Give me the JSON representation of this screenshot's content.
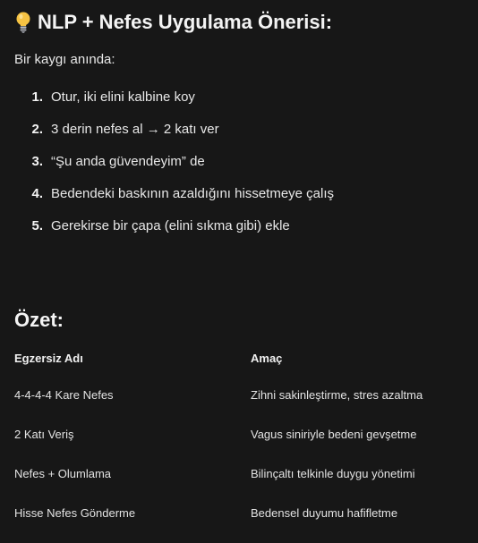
{
  "title": {
    "icon": "lightbulb-icon",
    "text": "NLP + Nefes Uygulama Önerisi:"
  },
  "intro": "Bir kaygı anında:",
  "steps": [
    {
      "number": "1.",
      "text": "Otur, iki elini kalbine koy"
    },
    {
      "number": "2.",
      "text": "3 derin nefes al → 2 katı ver"
    },
    {
      "number": "3.",
      "text": "“Şu anda güvendeyim” de"
    },
    {
      "number": "4.",
      "text": "Bedendeki baskının azaldığını hissetmeye çalış"
    },
    {
      "number": "5.",
      "text": "Gerekirse bir çapa (elini sıkma gibi) ekle"
    }
  ],
  "summary": {
    "heading": "Özet:",
    "columns": [
      "Egzersiz Adı",
      "Amaç"
    ],
    "rows": [
      [
        "4-4-4-4 Kare Nefes",
        "Zihni sakinleştirme, stres azaltma"
      ],
      [
        "2 Katı Veriş",
        "Vagus siniriyle bedeni gevşetme"
      ],
      [
        "Nefes + Olumlama",
        "Bilinçaltı telkinle duygu yönetimi"
      ],
      [
        "Hisse Nefes Gönderme",
        "Bedensel duyumu hafifletme"
      ]
    ]
  },
  "colors": {
    "background": "#171717",
    "text": "#ececec",
    "bulb": "#f6c343"
  }
}
